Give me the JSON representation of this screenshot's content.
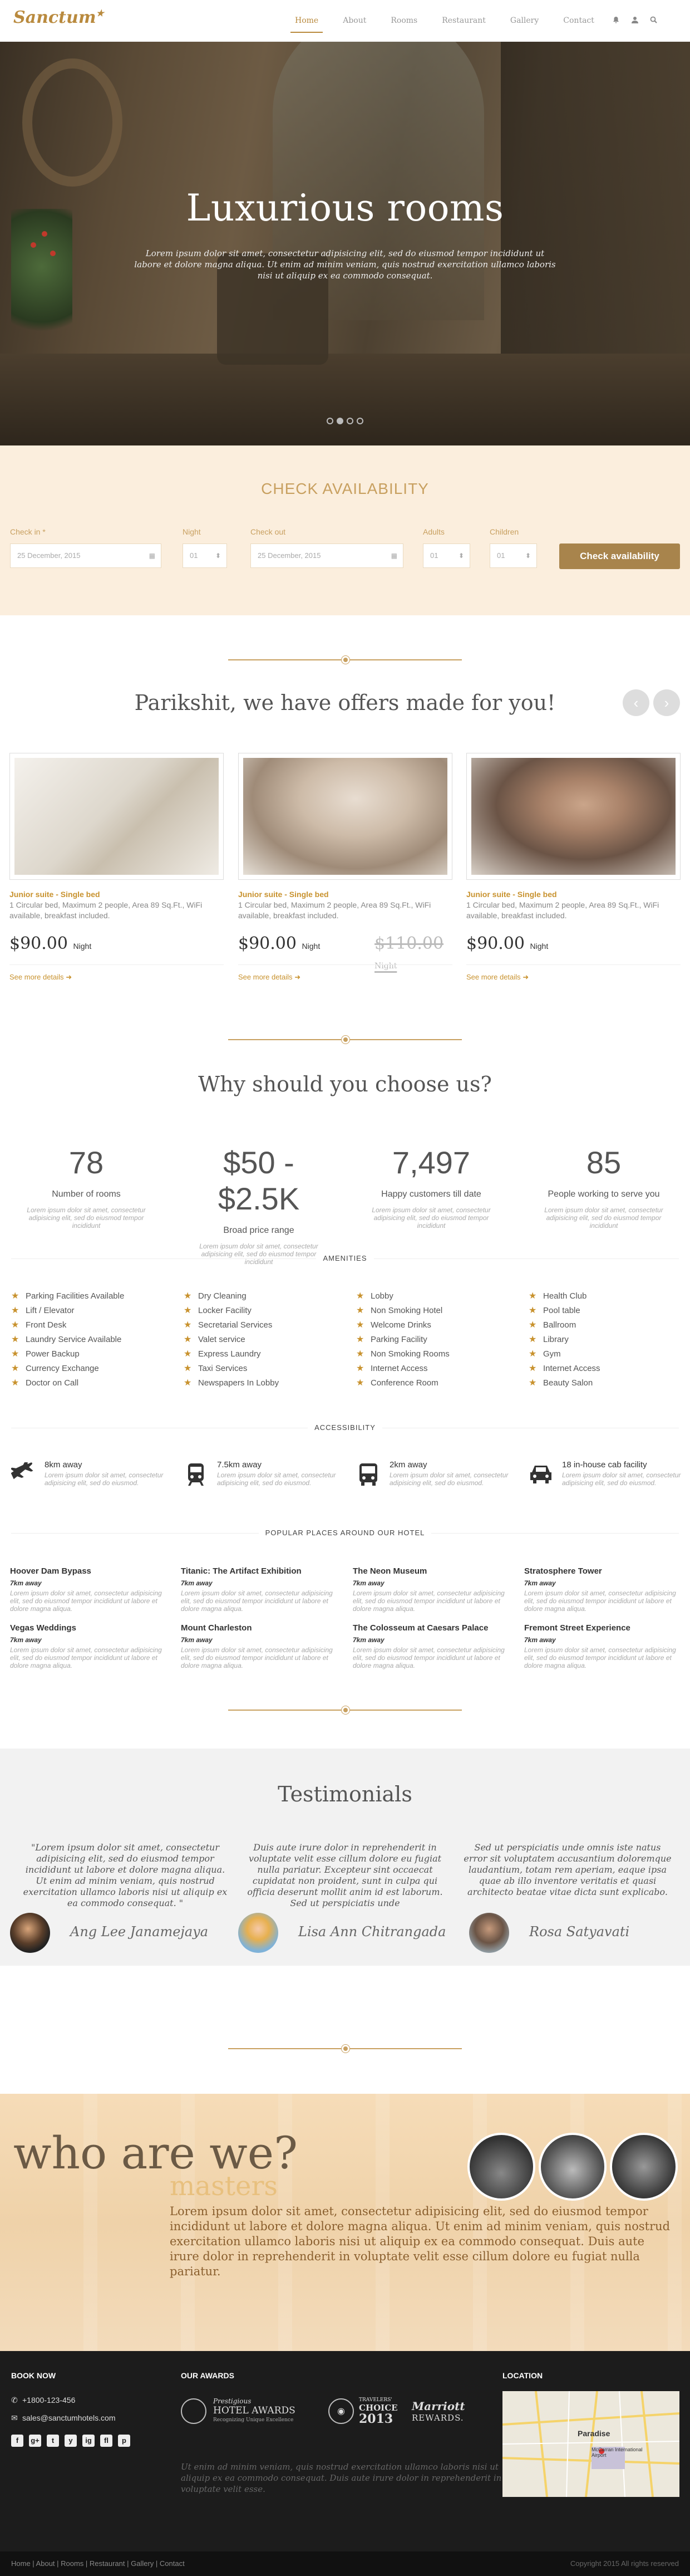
{
  "brand": {
    "name": "Sanctum",
    "accent": "#b98a3e",
    "accent_light": "#c8a060",
    "cream": "#fbeedd"
  },
  "nav": {
    "items": [
      "Home",
      "About",
      "Rooms",
      "Restaurant",
      "Gallery",
      "Contact"
    ],
    "active": "Home",
    "icons": [
      "bell-icon",
      "user-icon",
      "search-icon"
    ]
  },
  "hero": {
    "title": "Luxurious rooms",
    "text": "Lorem ipsum dolor sit amet, consectetur adipisicing elit, sed do eiusmod tempor incididunt ut labore et dolore magna aliqua. Ut enim ad minim veniam, quis nostrud exercitation ullamco laboris nisi ut aliquip ex ea commodo consequat.",
    "slides": 4,
    "active_slide": 2
  },
  "availability": {
    "title": "CHECK AVAILABILITY",
    "fields": {
      "checkin": {
        "label": "Check in *",
        "value": "25 December, 2015"
      },
      "night": {
        "label": "Night",
        "value": "01"
      },
      "checkout": {
        "label": "Check out",
        "value": "25 December, 2015"
      },
      "adults": {
        "label": "Adults",
        "value": "01"
      },
      "children": {
        "label": "Children",
        "value": "01"
      }
    },
    "button": "Check availability"
  },
  "offers": {
    "title": "Parikshit, we have offers made for you!",
    "prev": "‹",
    "next": "›",
    "cards": [
      {
        "title": "Junior suite - Single bed",
        "desc": "1 Circular bed, Maximum 2 people, Area 89 Sq.Ft., WiFi available, breakfast included.",
        "price": "$90.00",
        "unit": "Night",
        "old_price": "",
        "old_unit": "",
        "more": "See more details"
      },
      {
        "title": "Junior suite - Single bed",
        "desc": "1 Circular bed, Maximum 2 people, Area 89 Sq.Ft., WiFi available, breakfast included.",
        "price": "$90.00",
        "unit": "Night",
        "old_price": "$110.00",
        "old_unit": "Night",
        "more": "See more details"
      },
      {
        "title": "Junior suite - Single bed",
        "desc": "1 Circular bed, Maximum 2 people, Area 89 Sq.Ft., WiFi available, breakfast included.",
        "price": "$90.00",
        "unit": "Night",
        "old_price": "",
        "old_unit": "",
        "more": "See more details"
      }
    ]
  },
  "why": {
    "title": "Why should you choose us?",
    "stats": [
      {
        "num": "78",
        "label": "Number of rooms",
        "text": "Lorem ipsum dolor sit amet, consectetur adipisicing elit, sed do eiusmod tempor incididunt"
      },
      {
        "num": "$50 - $2.5K",
        "label": "Broad price range",
        "text": "Lorem ipsum dolor sit amet, consectetur adipisicing elit, sed do eiusmod tempor incididunt"
      },
      {
        "num": "7,497",
        "label": "Happy customers till date",
        "text": "Lorem ipsum dolor sit amet, consectetur adipisicing elit, sed do eiusmod tempor incididunt"
      },
      {
        "num": "85",
        "label": "People working to serve you",
        "text": "Lorem ipsum dolor sit amet, consectetur adipisicing elit, sed do eiusmod tempor incididunt"
      }
    ]
  },
  "amenities": {
    "title": "AMENITIES",
    "columns": [
      [
        "Parking Facilities Available",
        "Lift / Elevator",
        "Front Desk",
        "Laundry Service Available",
        "Power Backup",
        "Currency Exchange",
        "Doctor on Call"
      ],
      [
        "Dry Cleaning",
        "Locker Facility",
        "Secretarial Services",
        "Valet service",
        "Express Laundry",
        "Taxi Services",
        "Newspapers In Lobby"
      ],
      [
        "Lobby",
        "Non Smoking Hotel",
        "Welcome Drinks",
        "Parking Facility",
        "Non Smoking Rooms",
        "Internet Access",
        "Conference Room"
      ],
      [
        "Health Club",
        "Pool table",
        "Ballroom",
        "Library",
        "Gym",
        "Internet Access",
        "Beauty Salon"
      ]
    ]
  },
  "accessibility": {
    "title": "ACCESSIBILITY",
    "items": [
      {
        "icon": "airplane-icon",
        "title": "8km away",
        "text": "Lorem ipsum dolor sit amet, consectetur adipisicing elit, sed do eiusmod."
      },
      {
        "icon": "train-icon",
        "title": "7.5km away",
        "text": "Lorem ipsum dolor sit amet, consectetur adipisicing elit, sed do eiusmod."
      },
      {
        "icon": "bus-icon",
        "title": "2km away",
        "text": "Lorem ipsum dolor sit amet, consectetur adipisicing elit, sed do eiusmod."
      },
      {
        "icon": "car-icon",
        "title": "18 in-house cab facility",
        "text": "Lorem ipsum dolor sit amet, consectetur adipisicing elit, sed do eiusmod."
      }
    ]
  },
  "places": {
    "title": "POPULAR PLACES AROUND OUR HOTEL",
    "items": [
      {
        "title": "Hoover Dam Bypass",
        "dist": "7km away",
        "text": "Lorem ipsum dolor sit amet, consectetur adipisicing elit, sed do eiusmod tempor incididunt ut labore et dolore magna aliqua."
      },
      {
        "title": "Titanic: The Artifact Exhibition",
        "dist": "7km away",
        "text": "Lorem ipsum dolor sit amet, consectetur adipisicing elit, sed do eiusmod tempor incididunt ut labore et dolore magna aliqua."
      },
      {
        "title": "The Neon Museum",
        "dist": "7km away",
        "text": "Lorem ipsum dolor sit amet, consectetur adipisicing elit, sed do eiusmod tempor incididunt ut labore et dolore magna aliqua."
      },
      {
        "title": "Stratosphere Tower",
        "dist": "7km away",
        "text": "Lorem ipsum dolor sit amet, consectetur adipisicing elit, sed do eiusmod tempor incididunt ut labore et dolore magna aliqua."
      },
      {
        "title": "Vegas Weddings",
        "dist": "7km away",
        "text": "Lorem ipsum dolor sit amet, consectetur adipisicing elit, sed do eiusmod tempor incididunt ut labore et dolore magna aliqua."
      },
      {
        "title": "Mount Charleston",
        "dist": "7km away",
        "text": "Lorem ipsum dolor sit amet, consectetur adipisicing elit, sed do eiusmod tempor incididunt ut labore et dolore magna aliqua."
      },
      {
        "title": "The Colosseum at Caesars Palace",
        "dist": "7km away",
        "text": "Lorem ipsum dolor sit amet, consectetur adipisicing elit, sed do eiusmod tempor incididunt ut labore et dolore magna aliqua."
      },
      {
        "title": "Fremont Street Experience",
        "dist": "7km away",
        "text": "Lorem ipsum dolor sit amet, consectetur adipisicing elit, sed do eiusmod tempor incididunt ut labore et dolore magna aliqua."
      }
    ]
  },
  "testimonials": {
    "title": "Testimonials",
    "items": [
      {
        "quote": "\"Lorem ipsum dolor sit amet, consectetur adipisicing elit, sed do eiusmod tempor incididunt ut labore et dolore magna aliqua. Ut enim ad minim veniam, quis nostrud exercitation ullamco laboris nisi ut aliquip ex ea commodo consequat. \"",
        "name": "Ang Lee Janamejaya"
      },
      {
        "quote": "Duis aute irure dolor in reprehenderit in voluptate velit esse cillum dolore eu fugiat nulla pariatur. Excepteur sint occaecat cupidatat non proident, sunt in culpa qui officia deserunt mollit anim id est laborum. Sed ut perspiciatis unde",
        "name": "Lisa Ann Chitrangada"
      },
      {
        "quote": "Sed ut perspiciatis unde omnis iste natus error sit voluptatem accusantium doloremque laudantium, totam rem aperiam, eaque ipsa quae ab illo inventore veritatis et quasi architecto beatae vitae dicta sunt explicabo.",
        "name": "Rosa Satyavati"
      }
    ]
  },
  "who": {
    "title": "who are we?",
    "subtitle": "masters",
    "text": "Lorem ipsum dolor sit amet, consectetur adipisicing elit, sed do eiusmod tempor incididunt ut labore et dolore magna aliqua. Ut enim ad minim veniam, quis nostrud exercitation ullamco laboris nisi ut aliquip ex ea commodo consequat. Duis aute irure dolor in reprehenderit in voluptate velit esse cillum dolore eu fugiat nulla pariatur."
  },
  "footer": {
    "book_title": "BOOK NOW",
    "phone": "+1800-123-456",
    "email": "sales@sanctumhotels.com",
    "social": [
      "f",
      "g+",
      "t",
      "y",
      "ig",
      "fl",
      "p"
    ],
    "awards_title": "OUR AWARDS",
    "awards": [
      {
        "line1": "Prestigious",
        "line2": "HOTEL AWARDS",
        "line3": "Recognizing Unique Excellence"
      },
      {
        "line1": "TRAVELERS'",
        "line2": "CHOICE",
        "line3": "2013"
      },
      {
        "line1": "Marriott",
        "line2": "REWARDS.",
        "line3": ""
      }
    ],
    "italic": "Ut enim ad minim veniam, quis nostrud exercitation ullamco laboris nisi ut aliquip ex ea commodo consequat. Duis aute irure dolor in reprehenderit in voluptate velit esse.",
    "location_title": "LOCATION",
    "map_labels": {
      "city": "Paradise",
      "airport": "McCarran International Airport"
    },
    "bottom_links": "Home | About | Rooms | Restaurant | Gallery | Contact",
    "copyright": "Copyright 2015 All rights reserved"
  }
}
